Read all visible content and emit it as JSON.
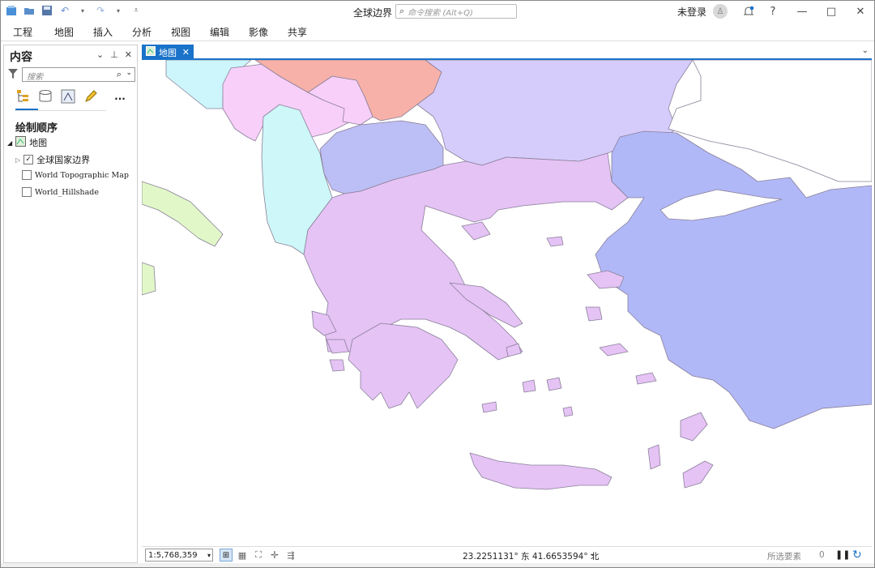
{
  "app": {
    "title": "全球边界"
  },
  "command_search": {
    "placeholder": "命令搜索 (Alt+Q)"
  },
  "account": {
    "login_label": "未登录"
  },
  "window_controls": {
    "help": "?",
    "minimize": "—",
    "maximize": "□",
    "close": "✕"
  },
  "menu": {
    "items": [
      "工程",
      "地图",
      "插入",
      "分析",
      "视图",
      "编辑",
      "影像",
      "共享"
    ]
  },
  "contents_pane": {
    "title": "内容",
    "search_placeholder": "搜索",
    "more_label": "...",
    "section_title": "绘制顺序",
    "map_node": "地图",
    "layers": [
      {
        "name": "全球国家边界",
        "checked": true
      },
      {
        "name": "World Topographic Map",
        "checked": false
      },
      {
        "name": "World_Hillshade",
        "checked": false
      }
    ]
  },
  "map_tab": {
    "label": "地图"
  },
  "status": {
    "scale": "1:5,768,359",
    "coordinates": "23.2251131° 东 41.6653594° 北",
    "selected_features_label": "所选要素",
    "selected_count": "0"
  },
  "colors": {
    "accent": "#1a73c9",
    "greece": "#e5c3f5",
    "bulgaria": "#d6ccfb",
    "turkey": "#b0b8f7",
    "serbia": "#f7b1a9",
    "kosovo_montenegro": "#f7cff8",
    "albania": "#cdf7f8",
    "macedonia": "#bcbff5",
    "italy": "#e1f7c8",
    "croatia": "#ccf6fb",
    "coast_stroke": "#8a7f99"
  }
}
